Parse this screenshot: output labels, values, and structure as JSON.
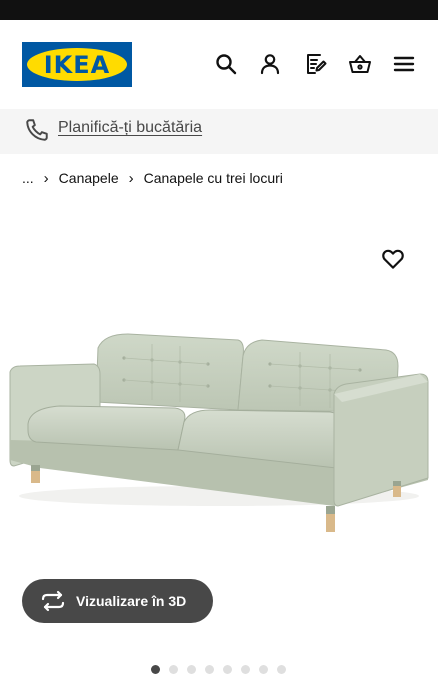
{
  "header": {
    "logo_text": "IKEA",
    "icons": [
      "search-icon",
      "profile-icon",
      "shopping-list-icon",
      "basket-icon",
      "menu-icon"
    ]
  },
  "promo": {
    "icon": "phone-icon",
    "link_text": "Planifică-ți bucătăria"
  },
  "breadcrumb": {
    "items": [
      "...",
      "Canapele",
      "Canapele cu trei locuri"
    ],
    "separator": "›"
  },
  "product": {
    "favourite_icon": "heart-icon",
    "image_alt": "Canapea cu trei locuri, tapițerie verde deschis, picioare din lemn",
    "sofa_color": "#c9d3c2"
  },
  "view_3d": {
    "icon": "rotate-arrows-icon",
    "label": "Vizualizare în 3D"
  },
  "carousel": {
    "total": 8,
    "active_index": 1
  },
  "colors": {
    "ikea_blue": "#0058a3",
    "ikea_yellow": "#ffdb00",
    "button_dark": "#484848"
  }
}
